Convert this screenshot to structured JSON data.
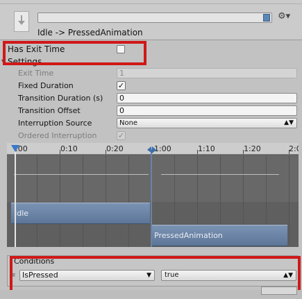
{
  "header": {
    "title": "Idle -> PressedAnimation",
    "search_value": "",
    "icon": "transition-icon",
    "settings_icon": "gear-icon"
  },
  "has_exit_time": {
    "label": "Has Exit Time",
    "checked": false
  },
  "settings": {
    "label": "Settings",
    "exit_time": {
      "label": "Exit Time",
      "value": "1"
    },
    "fixed_duration": {
      "label": "Fixed Duration",
      "checked": true
    },
    "transition_duration": {
      "label": "Transition Duration (s)",
      "value": "0"
    },
    "transition_offset": {
      "label": "Transition Offset",
      "value": "0"
    },
    "interruption_source": {
      "label": "Interruption Source",
      "value": "None"
    },
    "ordered_interruption": {
      "label": "Ordered Interruption",
      "checked": true
    }
  },
  "timeline": {
    "ticks": [
      ":00",
      "0:10",
      "0:20",
      "1:00",
      "1:10",
      "1:20",
      "2:0"
    ],
    "clips": [
      {
        "name": "Idle"
      },
      {
        "name": "PressedAnimation"
      }
    ]
  },
  "conditions": {
    "label": "Conditions",
    "parameter": "IsPressed",
    "value": "true"
  },
  "colors": {
    "highlight_box": "#d01818",
    "clip_fill": "#6a84a6",
    "timeline_bg": "#5f5f5f"
  }
}
